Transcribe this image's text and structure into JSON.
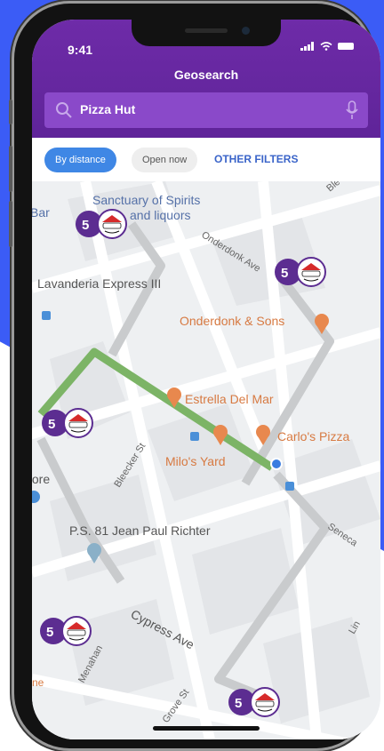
{
  "status_bar": {
    "time": "9:41"
  },
  "header": {
    "title": "Geosearch"
  },
  "search": {
    "value": "Pizza Hut"
  },
  "filters": {
    "by_distance": "By distance",
    "open_now": "Open now",
    "other_filters": "OTHER FILTERS"
  },
  "map": {
    "labels": {
      "sanctuary_1": "Sanctuary of Spirits",
      "sanctuary_2": "and liquors",
      "bar_partial": "Bar",
      "lavanderia": "Lavanderia Express III",
      "onderdonk_ave": "Onderdonk Ave",
      "onderdonk_sons": "Onderdonk & Sons",
      "estrella": "Estrella Del Mar",
      "carlos": "Carlo's Pizza",
      "milos": "Milo's Yard",
      "bleecker": "Bleecker St",
      "store_partial": "tore",
      "ps81": "P.S. 81 Jean Paul Richter",
      "seneca": "Seneca",
      "cypress": "Cypress Ave",
      "menahan": "Menahan",
      "grove": "Grove St",
      "lindens": "Lin",
      "ble": "Ble",
      "ne_partial": "ne"
    },
    "pin_brand": "Pizza Hut",
    "colors": {
      "route": "#7cb466",
      "road": "#c9cbcd",
      "poi_orange": "#e8884e",
      "poi_blue": "#4a8fd8",
      "pin_purple": "#5c2d91"
    }
  }
}
